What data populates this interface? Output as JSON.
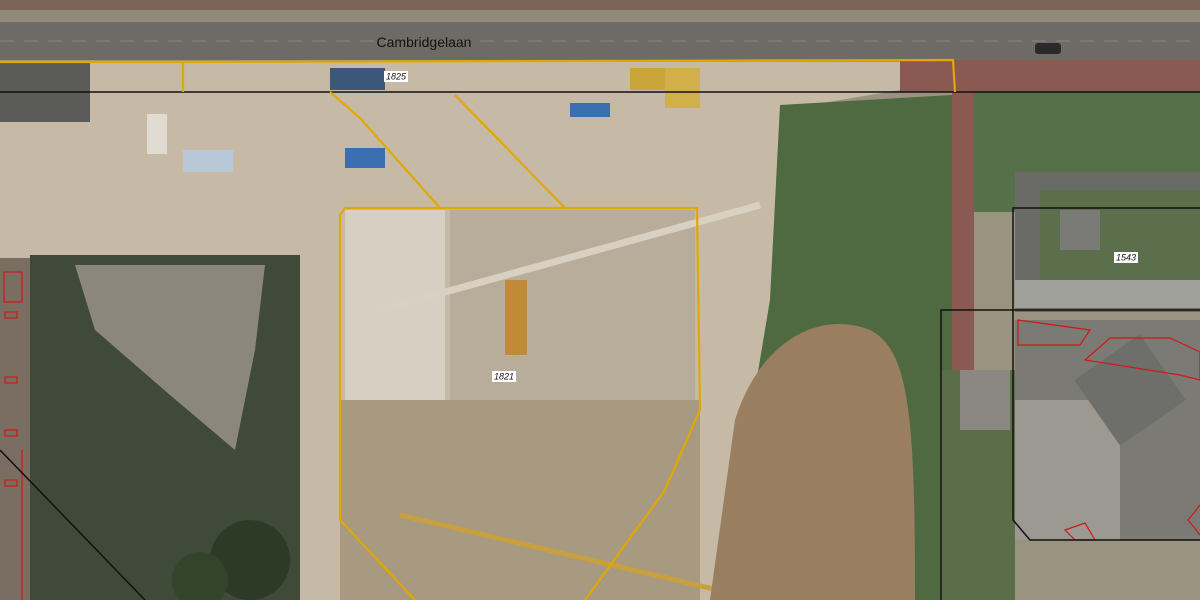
{
  "map": {
    "street_label": "Cambridgelaan",
    "parcels": [
      {
        "id": "parcel-1825",
        "label": "1825"
      },
      {
        "id": "parcel-1821",
        "label": "1821"
      },
      {
        "id": "parcel-1543",
        "label": "1543"
      }
    ],
    "colors": {
      "highlight_outline": "#e0a800",
      "parcel_outline": "#111111",
      "building_outline": "#d01818",
      "road": "#6e6a66",
      "bike_path": "#8a5a52",
      "grass": "#4f6a40",
      "sand": "#c6baa6"
    }
  }
}
